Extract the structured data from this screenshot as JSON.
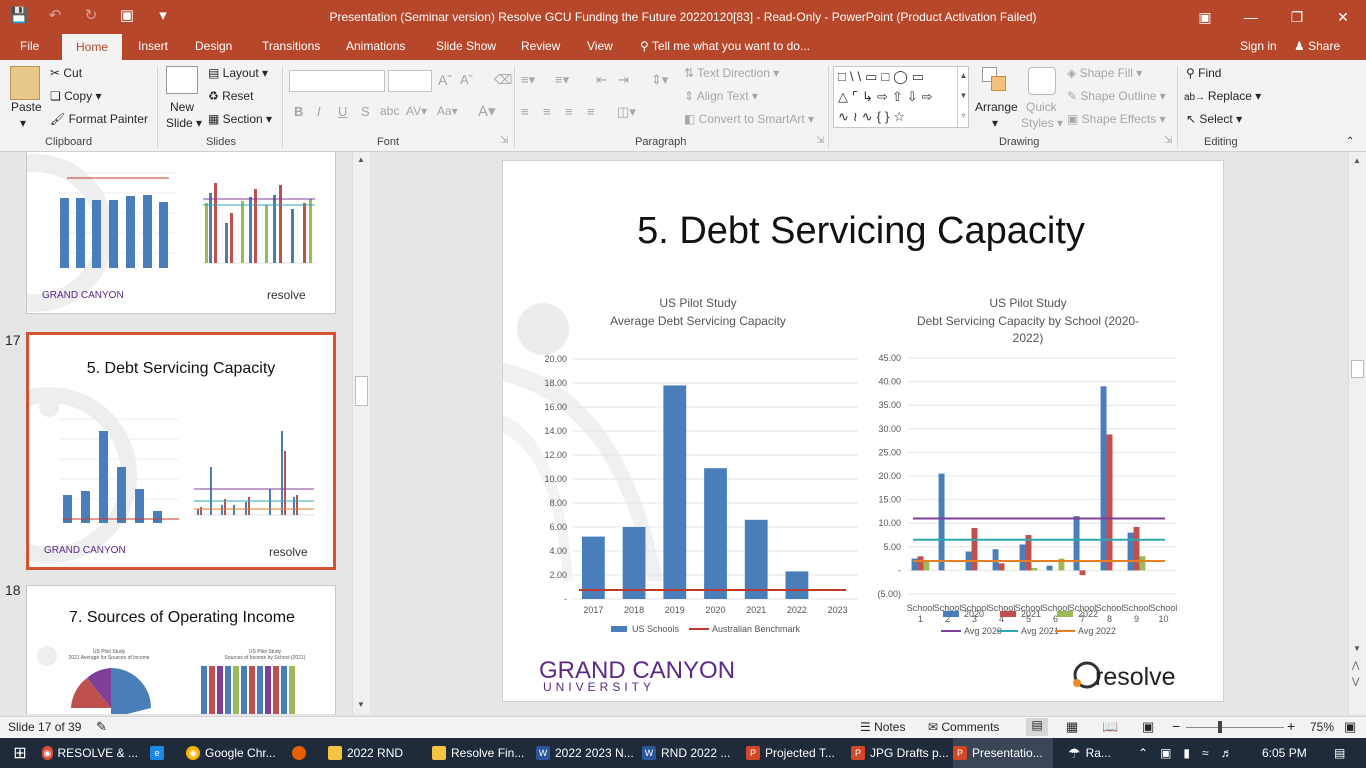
{
  "window": {
    "title": "Presentation (Seminar version) Resolve GCU Funding the Future 20220120[83]  -  Read-Only - PowerPoint (Product Activation Failed)"
  },
  "tabs": [
    {
      "label": "File"
    },
    {
      "label": "Home"
    },
    {
      "label": "Insert"
    },
    {
      "label": "Design"
    },
    {
      "label": "Transitions"
    },
    {
      "label": "Animations"
    },
    {
      "label": "Slide Show"
    },
    {
      "label": "Review"
    },
    {
      "label": "View"
    }
  ],
  "tellme": "Tell me what you want to do...",
  "signin": "Sign in",
  "share": "Share",
  "ribbon": {
    "clipboard": {
      "paste": "Paste",
      "cut": "Cut",
      "copy": "Copy",
      "format_painter": "Format Painter",
      "label": "Clipboard"
    },
    "slides": {
      "new_slide": "New",
      "new_slide2": "Slide",
      "layout": "Layout",
      "reset": "Reset",
      "section": "Section",
      "label": "Slides"
    },
    "font": {
      "label": "Font"
    },
    "paragraph": {
      "text_direction": "Text Direction",
      "align_text": "Align Text",
      "smartart": "Convert to SmartArt",
      "label": "Paragraph"
    },
    "drawing": {
      "arrange": "Arrange",
      "quick": "Quick",
      "styles": "Styles",
      "shape_fill": "Shape Fill",
      "shape_outline": "Shape Outline",
      "shape_effects": "Shape Effects",
      "label": "Drawing"
    },
    "editing": {
      "find": "Find",
      "replace": "Replace",
      "select": "Select",
      "label": "Editing"
    }
  },
  "thumbnails": {
    "n17": "17",
    "n18": "18",
    "t17": "5. Debt Servicing Capacity",
    "t18": "7. Sources of Operating Income",
    "t18_c1a": "US Pilot Study",
    "t18_c1b": "2021 Average for Sources of Income",
    "t18_c2b": "Sources of Income by School (2021)"
  },
  "slide": {
    "title": "5. Debt Servicing Capacity",
    "gcu_logo": "GRAND CANYON",
    "gcu_logo2": "UNIVERSITY",
    "resolve_logo": "resolve"
  },
  "chart_data": [
    {
      "type": "bar",
      "title": "US Pilot Study",
      "subtitle": "Average Debt Servicing Capacity",
      "categories": [
        "2017",
        "2018",
        "2019",
        "2020",
        "2021",
        "2022",
        "2023"
      ],
      "series": [
        {
          "name": "US Schools",
          "values": [
            5.2,
            6.0,
            17.8,
            10.9,
            6.6,
            2.3,
            0
          ],
          "color": "#4a7ebb"
        }
      ],
      "lines": [
        {
          "name": "Australian Benchmark",
          "value": 0.75,
          "color": "#c0392b"
        }
      ],
      "yticks": [
        "20.00",
        "18.00",
        "16.00",
        "14.00",
        "12.00",
        "10.00",
        "8.00",
        "6.00",
        "4.00",
        "2.00",
        "-"
      ],
      "ylim": [
        0,
        20
      ],
      "grid": true,
      "legend": "bottom"
    },
    {
      "type": "bar",
      "title": "US Pilot Study",
      "subtitle": "Debt Servicing Capacity by School (2020-",
      "subtitle2": "2022)",
      "categories": [
        "School 1",
        "School 2",
        "School 3",
        "School 4",
        "School 5",
        "School 6",
        "School 7",
        "School 8",
        "School 9",
        "School 10"
      ],
      "category_lines": [
        [
          "School",
          "1"
        ],
        [
          "School",
          "2"
        ],
        [
          "School",
          "3"
        ],
        [
          "School",
          "4"
        ],
        [
          "School",
          "5"
        ],
        [
          "School",
          "6"
        ],
        [
          "School",
          "7"
        ],
        [
          "School",
          "8"
        ],
        [
          "School",
          "9"
        ],
        [
          "School",
          "10"
        ]
      ],
      "series": [
        {
          "name": "2020",
          "values": [
            2.5,
            20.5,
            4.0,
            4.5,
            5.5,
            1.0,
            11.5,
            39.0,
            8.0,
            0
          ],
          "color": "#4a7ebb"
        },
        {
          "name": "2021",
          "values": [
            3.0,
            0,
            9.0,
            1.5,
            7.5,
            0,
            -1.0,
            28.8,
            9.2,
            0
          ],
          "color": "#c0504d"
        },
        {
          "name": "2022",
          "values": [
            2.0,
            0,
            0,
            0,
            0.5,
            2.5,
            0,
            0,
            3.0,
            0
          ],
          "color": "#9bbb59"
        }
      ],
      "lines": [
        {
          "name": "Avg 2020",
          "value": 11.0,
          "color": "#7f3f98"
        },
        {
          "name": "Avg 2021",
          "value": 6.5,
          "color": "#2ea8b5"
        },
        {
          "name": "Avg 2022",
          "value": 2.0,
          "color": "#e67e22"
        }
      ],
      "yticks": [
        "45.00",
        "40.00",
        "35.00",
        "30.00",
        "25.00",
        "20.00",
        "15.00",
        "10.00",
        "5.00",
        "-",
        "(5.00)"
      ],
      "ylim": [
        -5,
        45
      ],
      "grid": true,
      "legend": "bottom"
    }
  ],
  "status": {
    "slide": "Slide 17 of 39",
    "notes": "Notes",
    "comments": "Comments",
    "zoom": "75%"
  },
  "taskbar": [
    {
      "label": "RESOLVE & ..."
    },
    {
      "label": "Google Chr..."
    },
    {
      "label": "2022 RND"
    },
    {
      "label": "Resolve Fin..."
    },
    {
      "label": "2022 2023 N..."
    },
    {
      "label": "RND 2022 ..."
    },
    {
      "label": "Projected T..."
    },
    {
      "label": "JPG Drafts p..."
    },
    {
      "label": "Presentatio..."
    },
    {
      "label": "Ra..."
    }
  ],
  "clock": "6:05 PM"
}
